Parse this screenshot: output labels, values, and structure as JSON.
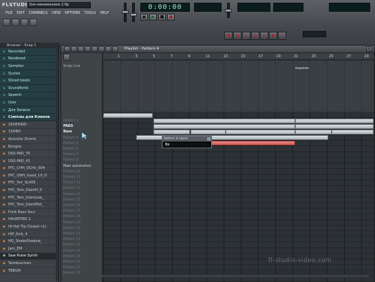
{
  "app": {
    "logo": "FLSTUDIO",
    "title_field": "Бэк-минимализм 2.flp",
    "menu": [
      "FILE",
      "EDIT",
      "CHANNELS",
      "VIEW",
      "OPTIONS",
      "TOOLS",
      "HELP"
    ],
    "time_display": "0:00:00"
  },
  "browser": {
    "header": "Browser - Snap 1",
    "items": [
      {
        "label": "Recorded",
        "kind": "folder"
      },
      {
        "label": "Rendered",
        "kind": "folder"
      },
      {
        "label": "Samples",
        "kind": "folder"
      },
      {
        "label": "Scores",
        "kind": "folder"
      },
      {
        "label": "Sliced beats",
        "kind": "folder"
      },
      {
        "label": "Soundfonts",
        "kind": "folder"
      },
      {
        "label": "Speech",
        "kind": "folder"
      },
      {
        "label": "User",
        "kind": "folder"
      },
      {
        "label": "Для Записи",
        "kind": "folder"
      },
      {
        "label": "Сэмплы для Клипов",
        "kind": "folder"
      },
      {
        "label": "1KVEHIND",
        "kind": "file"
      },
      {
        "label": "1SHRD",
        "kind": "file"
      },
      {
        "label": "Acoustic Drums",
        "kind": "file"
      },
      {
        "label": "Bongos",
        "kind": "file"
      },
      {
        "label": "DSS-PAD_35",
        "kind": "file"
      },
      {
        "label": "DSS-PAD_41",
        "kind": "file"
      },
      {
        "label": "FPC_CHH_OCHs_004",
        "kind": "file"
      },
      {
        "label": "FPC_OHH_Good_10_D",
        "kind": "file"
      },
      {
        "label": "FPC_Snr_SL005",
        "kind": "file"
      },
      {
        "label": "FPC_Tom_GlomH_0",
        "kind": "file"
      },
      {
        "label": "FPC_Tom_GlomLow_",
        "kind": "file"
      },
      {
        "label": "FPC_Tom_GlomMid_",
        "kind": "file"
      },
      {
        "label": "Funk Bass Soul",
        "kind": "file"
      },
      {
        "label": "HAUNTING 1",
        "kind": "file"
      },
      {
        "label": "Hi-Hat Tip Closed <Li",
        "kind": "file"
      },
      {
        "label": "HIP_Kick_4",
        "kind": "file"
      },
      {
        "label": "HQ_ShakeShadow_",
        "kind": "file"
      },
      {
        "label": "Jam_EM",
        "kind": "file"
      },
      {
        "label": "Saw Pulse Synth",
        "kind": "file",
        "selected": true
      },
      {
        "label": "Tambourines",
        "kind": "file"
      },
      {
        "label": "TBRUN",
        "kind": "file"
      }
    ]
  },
  "playlist": {
    "title": "Playlist - Pattern 4",
    "snap_label": "Snap Line",
    "ruler": [
      "1",
      "3",
      "5",
      "7",
      "9",
      "11",
      "13",
      "15",
      "17",
      "19",
      "21",
      "23",
      "25",
      "27",
      "29"
    ],
    "mini_marker": "Snapshot",
    "tracks": [
      {
        "label": "Pattern 1",
        "style": "dim"
      },
      {
        "label": "PADS",
        "style": "hl"
      },
      {
        "label": "Bass",
        "style": "hl"
      },
      {
        "label": "Pattern 4",
        "style": "dim"
      },
      {
        "label": "Pattern 5",
        "style": "dim"
      },
      {
        "label": "Pattern 6",
        "style": "dim"
      },
      {
        "label": "Pattern 7",
        "style": "dim"
      },
      {
        "label": "Pattern 8",
        "style": "dim"
      },
      {
        "label": "Main automation",
        "style": "mid"
      },
      {
        "label": "Pattern 10",
        "style": "dim"
      },
      {
        "label": "Pattern 11",
        "style": "dim"
      },
      {
        "label": "Pattern 12",
        "style": "dim"
      },
      {
        "label": "Pattern 13",
        "style": "dim"
      },
      {
        "label": "Pattern 14",
        "style": "dim"
      },
      {
        "label": "Pattern 15",
        "style": "dim"
      },
      {
        "label": "Pattern 16",
        "style": "dim"
      },
      {
        "label": "Pattern 17",
        "style": "dim"
      },
      {
        "label": "Pattern 18",
        "style": "dim"
      },
      {
        "label": "Pattern 19",
        "style": "dim"
      },
      {
        "label": "Pattern 20",
        "style": "dim"
      },
      {
        "label": "Pattern 21",
        "style": "dim"
      },
      {
        "label": "Pattern 22",
        "style": "dim"
      },
      {
        "label": "Pattern 23",
        "style": "dim"
      },
      {
        "label": "Pattern 24",
        "style": "dim"
      },
      {
        "label": "Pattern 25",
        "style": "dim"
      },
      {
        "label": "Pattern 26",
        "style": "dim"
      },
      {
        "label": "Pattern 27",
        "style": "dim"
      },
      {
        "label": "Pattern 28",
        "style": "dim"
      }
    ],
    "rename_popup": {
      "title": "Pattern 4 name",
      "value": "Ве"
    }
  },
  "watermark": "fl-studio-video.com",
  "colors": {
    "accent": "#e05f5c",
    "browser_folder": "#253e44",
    "lcd": "#9fe6d8"
  }
}
